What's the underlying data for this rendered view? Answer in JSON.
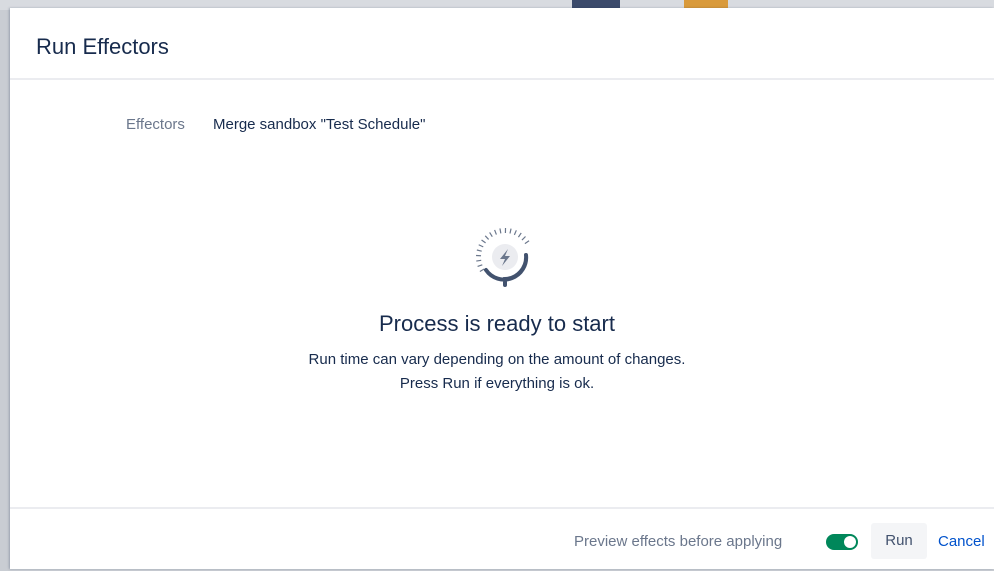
{
  "dialog": {
    "title": "Run Effectors"
  },
  "effectors": {
    "label": "Effectors",
    "value": "Merge sandbox \"Test Schedule\""
  },
  "status": {
    "icon": "stopwatch-lightning-icon",
    "title": "Process is ready to start",
    "line1": "Run time can vary depending on the amount of changes.",
    "line2": "Press Run if everything is ok."
  },
  "footer": {
    "preview_label": "Preview effects before applying",
    "preview_toggle_on": true,
    "run_label": "Run",
    "cancel_label": "Cancel"
  },
  "colors": {
    "text_primary": "#172b4d",
    "text_muted": "#6b778c",
    "toggle_on": "#00875a",
    "link": "#0052cc",
    "button_bg": "#f4f5f7"
  }
}
